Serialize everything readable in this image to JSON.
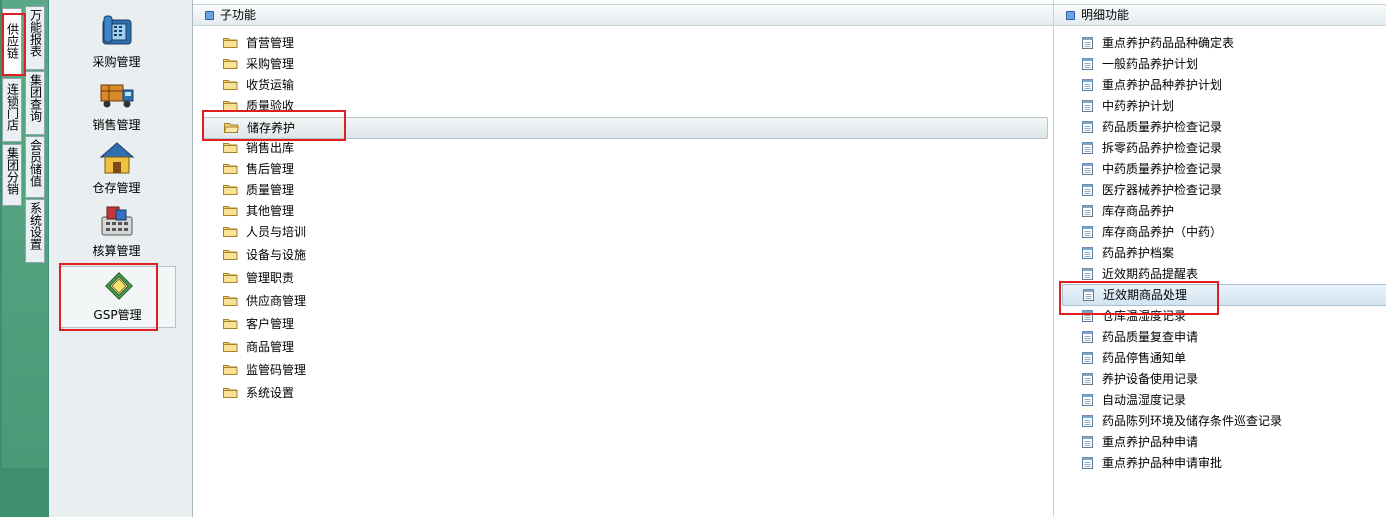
{
  "vertical_tabs": [
    {
      "label": "供应链"
    },
    {
      "label": "连锁门店"
    },
    {
      "label": "集团分销"
    },
    {
      "label": "万能报表"
    },
    {
      "label": "集团查询"
    },
    {
      "label": "会员储值"
    },
    {
      "label": "系统设置"
    }
  ],
  "modules": [
    {
      "label": "采购管理",
      "icon": "phone-icon"
    },
    {
      "label": "销售管理",
      "icon": "truck-icon"
    },
    {
      "label": "仓存管理",
      "icon": "warehouse-icon"
    },
    {
      "label": "核算管理",
      "icon": "calculator-icon"
    },
    {
      "label": "GSP管理",
      "icon": "gsp-certificate-icon"
    }
  ],
  "sub_panel": {
    "header": "子功能",
    "items": [
      "首营管理",
      "采购管理",
      "收货运输",
      "质量验收",
      "储存养护",
      "销售出库",
      "售后管理",
      "质量管理",
      "其他管理",
      "人员与培训",
      "设备与设施",
      "管理职责",
      "供应商管理",
      "客户管理",
      "商品管理",
      "监管码管理",
      "系统设置"
    ],
    "selected": "储存养护"
  },
  "detail_panel": {
    "header": "明细功能",
    "items": [
      "重点养护药品品种确定表",
      "一般药品养护计划",
      "重点养护品种养护计划",
      "中药养护计划",
      "药品质量养护检查记录",
      "拆零药品养护检查记录",
      "中药质量养护检查记录",
      "医疗器械养护检查记录",
      "库存商品养护",
      "库存商品养护（中药）",
      "药品养护档案",
      "近效期药品提醒表",
      "近效期商品处理",
      "仓库温湿度记录",
      "药品质量复查申请",
      "药品停售通知单",
      "养护设备使用记录",
      "自动温湿度记录",
      "药品陈列环境及储存条件巡查记录",
      "重点养护品种申请",
      "重点养护品种申请审批"
    ],
    "selected": "近效期商品处理"
  },
  "colors": {
    "highlight_box": "#e02020",
    "left_strip": "#4a9a78"
  }
}
